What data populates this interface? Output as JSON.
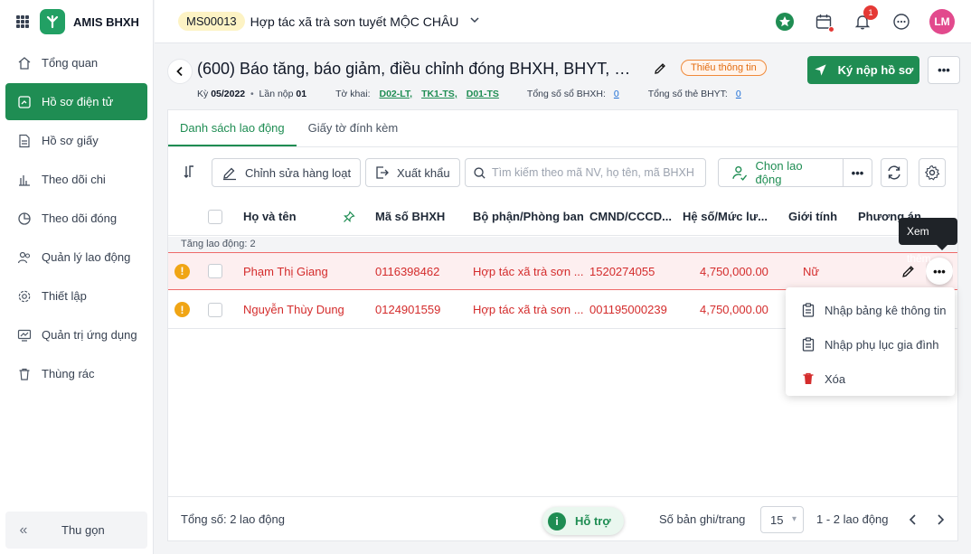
{
  "brand": {
    "name": "AMIS BHXH"
  },
  "sidebar": {
    "items": [
      {
        "label": "Tổng quan",
        "icon": "home-icon",
        "active": false
      },
      {
        "label": "Hồ sơ điện tử",
        "icon": "edoc-icon",
        "active": true
      },
      {
        "label": "Hồ sơ giấy",
        "icon": "doc-icon",
        "active": false
      },
      {
        "label": "Theo dõi chi",
        "icon": "chart-icon",
        "active": false
      },
      {
        "label": "Theo dõi đóng",
        "icon": "pie-icon",
        "active": false
      },
      {
        "label": "Quản lý lao động",
        "icon": "people-icon",
        "active": false
      },
      {
        "label": "Thiết lập",
        "icon": "gear-icon",
        "active": false
      },
      {
        "label": "Quản trị ứng dụng",
        "icon": "monitor-icon",
        "active": false
      },
      {
        "label": "Thùng rác",
        "icon": "trash-icon",
        "active": false
      }
    ],
    "collapse_label": "Thu gọn"
  },
  "topbar": {
    "org_code": "MS00013",
    "org_name": "Hợp tác xã trà sơn tuyết MỘC CHÂU",
    "notification_count": "1",
    "avatar_initials": "LM"
  },
  "header": {
    "title": "(600) Báo tăng, báo giảm, điều chỉnh đóng BHXH, BHYT, BHTN, BHTNLĐ, BNN",
    "status_tag": "Thiếu thông tin",
    "submit_label": "Ký nộp hồ sơ",
    "period_label": "Kỳ",
    "period_value": "05/2022",
    "submit_count_label": "Lần nộp",
    "submit_count_value": "01",
    "form_label": "Tờ khai:",
    "forms": [
      "D02-LT,",
      "TK1-TS,",
      "D01-TS"
    ],
    "bhxh_total_label": "Tổng số sổ BHXH:",
    "bhxh_total": "0",
    "bhyt_total_label": "Tổng số thẻ BHYT:",
    "bhyt_total": "0"
  },
  "tabs": [
    {
      "label": "Danh sách lao động",
      "active": true
    },
    {
      "label": "Giấy tờ đính kèm",
      "active": false
    }
  ],
  "toolbar": {
    "bulk_edit_label": "Chỉnh sửa hàng loạt",
    "export_label": "Xuất khẩu",
    "search_placeholder": "Tìm kiếm theo mã NV, họ tên, mã BHXH",
    "choose_worker_label": "Chọn lao động"
  },
  "table": {
    "columns": [
      "Họ và tên",
      "Mã số BHXH",
      "Bộ phận/Phòng ban",
      "CMND/CCCD...",
      "Hệ số/Mức lư...",
      "Giới tính",
      "Phương án"
    ],
    "group_label": "Tăng lao động: 2",
    "rows": [
      {
        "name": "Phạm Thị Giang",
        "bhxh": "0116398462",
        "dept": "Hợp tác xã trà sơn ...",
        "id_no": "1520274055",
        "salary": "4,750,000.00",
        "gender": "Nữ",
        "selected": true
      },
      {
        "name": "Nguyễn Thùy Dung",
        "bhxh": "0124901559",
        "dept": "Hợp tác xã trà sơn ...",
        "id_no": "001195000239",
        "salary": "4,750,000.00",
        "gender": "",
        "selected": false
      }
    ]
  },
  "tooltip": "Xem thêm",
  "row_menu": [
    {
      "label": "Nhập bảng kê thông tin",
      "icon": "clipboard-icon"
    },
    {
      "label": "Nhập phụ lục gia đình",
      "icon": "clipboard-icon"
    },
    {
      "label": "Xóa",
      "icon": "trash-icon"
    }
  ],
  "footer": {
    "total_label": "Tổng số:",
    "total_value": "2 lao động",
    "help_label": "Hỗ trợ",
    "per_page_label": "Số bản ghi/trang",
    "per_page_value": "15",
    "range_label": "1 - 2 lao động"
  },
  "colors": {
    "primary": "#1f8d53",
    "danger": "#d42c2c",
    "warning": "#f0a515"
  }
}
